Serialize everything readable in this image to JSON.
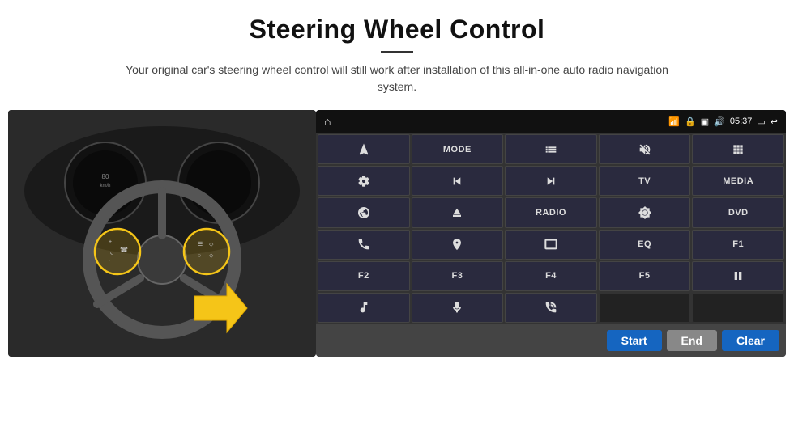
{
  "header": {
    "title": "Steering Wheel Control",
    "subtitle": "Your original car's steering wheel control will still work after installation of this all-in-one auto radio navigation system."
  },
  "status_bar": {
    "time": "05:37"
  },
  "buttons": [
    {
      "id": "nav",
      "type": "icon",
      "icon": "nav"
    },
    {
      "id": "mode",
      "type": "text",
      "label": "MODE"
    },
    {
      "id": "list",
      "type": "icon",
      "icon": "list"
    },
    {
      "id": "mute",
      "type": "icon",
      "icon": "mute"
    },
    {
      "id": "apps",
      "type": "icon",
      "icon": "apps"
    },
    {
      "id": "settings",
      "type": "icon",
      "icon": "settings"
    },
    {
      "id": "prev",
      "type": "icon",
      "icon": "prev"
    },
    {
      "id": "next",
      "type": "icon",
      "icon": "next"
    },
    {
      "id": "tv",
      "type": "text",
      "label": "TV"
    },
    {
      "id": "media",
      "type": "text",
      "label": "MEDIA"
    },
    {
      "id": "cam360",
      "type": "icon",
      "icon": "cam360"
    },
    {
      "id": "eject",
      "type": "icon",
      "icon": "eject"
    },
    {
      "id": "radio",
      "type": "text",
      "label": "RADIO"
    },
    {
      "id": "brightness",
      "type": "icon",
      "icon": "brightness"
    },
    {
      "id": "dvd",
      "type": "text",
      "label": "DVD"
    },
    {
      "id": "phone",
      "type": "icon",
      "icon": "phone"
    },
    {
      "id": "navi",
      "type": "icon",
      "icon": "navi"
    },
    {
      "id": "screen",
      "type": "icon",
      "icon": "screen"
    },
    {
      "id": "eq",
      "type": "text",
      "label": "EQ"
    },
    {
      "id": "f1",
      "type": "text",
      "label": "F1"
    },
    {
      "id": "f2",
      "type": "text",
      "label": "F2"
    },
    {
      "id": "f3",
      "type": "text",
      "label": "F3"
    },
    {
      "id": "f4",
      "type": "text",
      "label": "F4"
    },
    {
      "id": "f5",
      "type": "text",
      "label": "F5"
    },
    {
      "id": "playpause",
      "type": "icon",
      "icon": "playpause"
    },
    {
      "id": "music",
      "type": "icon",
      "icon": "music"
    },
    {
      "id": "mic",
      "type": "icon",
      "icon": "mic"
    },
    {
      "id": "call",
      "type": "icon",
      "icon": "call"
    },
    {
      "id": "empty1",
      "type": "empty"
    },
    {
      "id": "empty2",
      "type": "empty"
    }
  ],
  "bottom_bar": {
    "start_label": "Start",
    "end_label": "End",
    "clear_label": "Clear"
  }
}
